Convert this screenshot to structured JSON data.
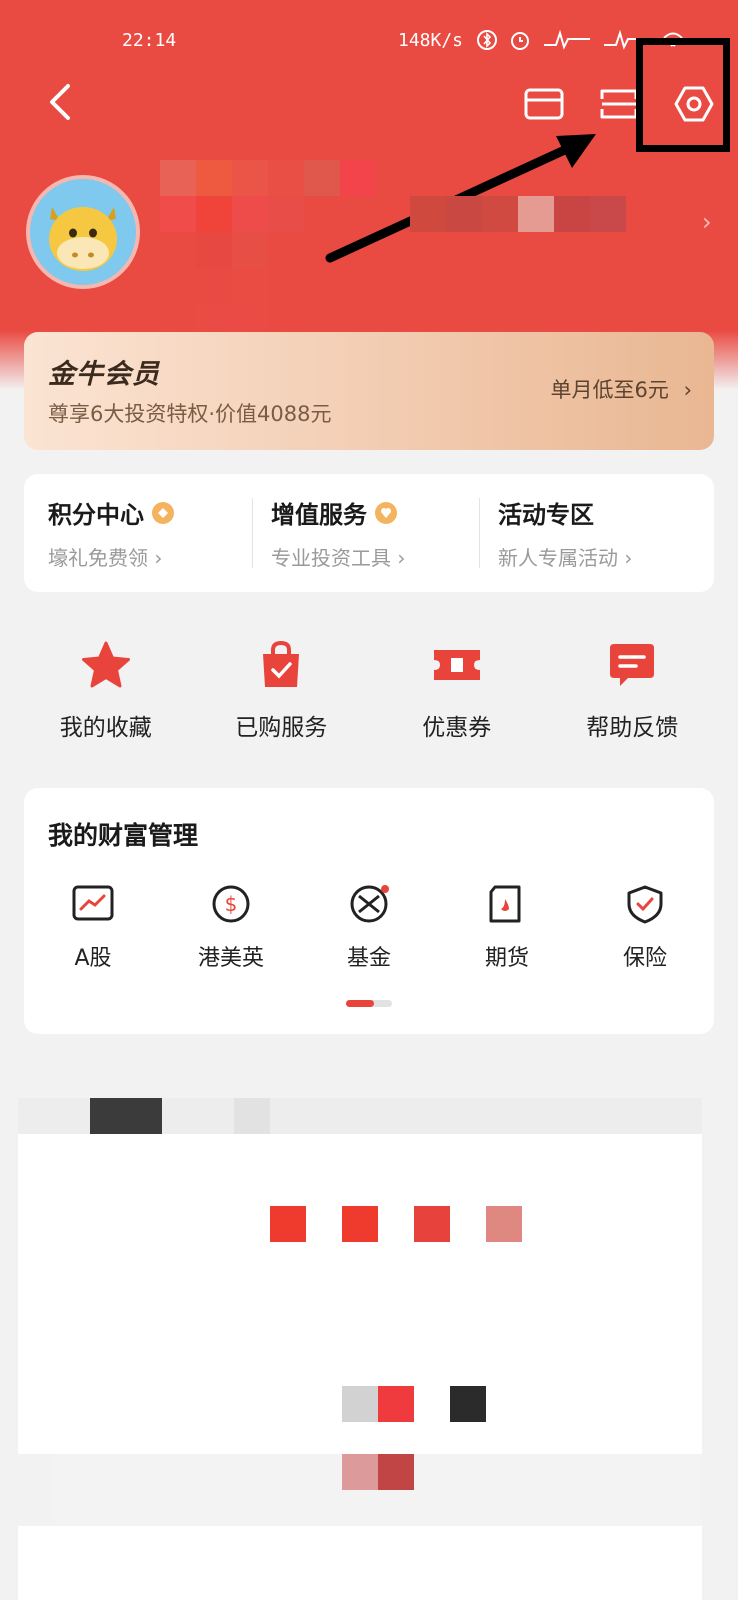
{
  "status_bar": {
    "time": "22:14",
    "speed": "148K/s"
  },
  "header": {
    "back_icon": "back-arrow-icon",
    "mail_icon": "mail-icon",
    "scan_icon": "scan-icon",
    "settings_icon": "settings-hexagon-icon"
  },
  "member": {
    "title": "金牛会员",
    "subtitle": "尊享6大投资特权·价值4088元",
    "action": "单月低至6元",
    "chevron": "›"
  },
  "services": [
    {
      "title": "积分中心",
      "sub": "壕礼免费领",
      "badge": true
    },
    {
      "title": "增值服务",
      "sub": "专业投资工具",
      "badge": true
    },
    {
      "title": "活动专区",
      "sub": "新人专属活动",
      "badge": false
    }
  ],
  "quick_actions": [
    {
      "label": "我的收藏",
      "icon": "star-icon"
    },
    {
      "label": "已购服务",
      "icon": "shopping-bag-icon"
    },
    {
      "label": "优惠券",
      "icon": "coupon-icon"
    },
    {
      "label": "帮助反馈",
      "icon": "feedback-icon"
    }
  ],
  "wealth": {
    "title": "我的财富管理",
    "items": [
      {
        "label": "A股",
        "icon": "stock-chart-icon"
      },
      {
        "label": "港美英",
        "icon": "dollar-icon"
      },
      {
        "label": "基金",
        "icon": "fund-icon"
      },
      {
        "label": "期货",
        "icon": "futures-icon"
      },
      {
        "label": "保险",
        "icon": "insurance-shield-icon"
      }
    ]
  },
  "colors": {
    "brand_red": "#e94a41",
    "gold": "#f4b45f"
  }
}
